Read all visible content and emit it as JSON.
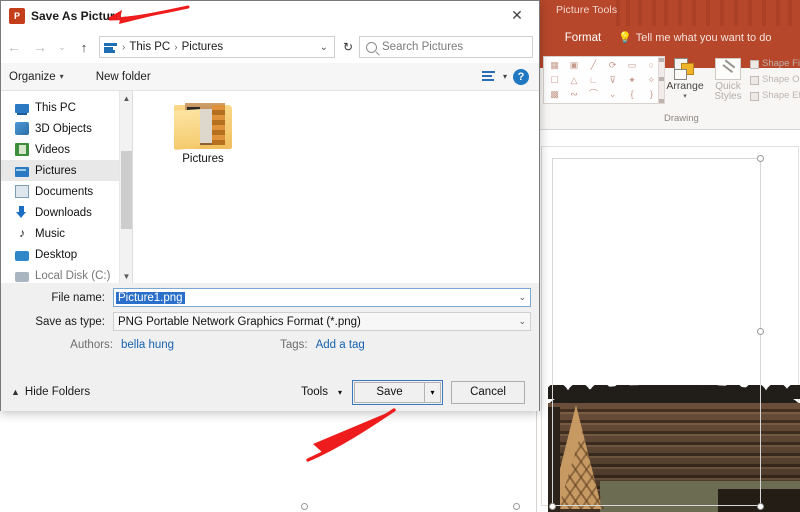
{
  "powerpoint": {
    "contextual_tab_group": "Picture Tools",
    "active_tab": "Format",
    "tell_me": "Tell me what you want to do",
    "ribbon_accent": "#b7472a",
    "drawing_group": {
      "label": "Drawing",
      "arrange_label": "Arrange",
      "quick_styles_label": "Quick Styles",
      "shape_fill_label": "Shape Fill",
      "shape_outline_label": "Shape Outline",
      "shape_effects_label": "Shape Effects"
    }
  },
  "dialog": {
    "title": "Save As Picture",
    "app_icon": "P",
    "close_icon": "close-icon",
    "nav": {
      "back_icon": "arrow-left-icon",
      "forward_icon": "arrow-right-icon",
      "recent_icon": "chevron-down-icon",
      "up_icon": "arrow-up-icon",
      "breadcrumbs": [
        "This PC",
        "Pictures"
      ],
      "separator": "›",
      "dropdown_caret": "⌄",
      "refresh_icon": "↻",
      "search_placeholder": "Search Pictures"
    },
    "toolbar": {
      "organize_label": "Organize",
      "organize_caret": "▾",
      "new_folder_label": "New folder",
      "view_icon": "view-layout-icon",
      "view_caret": "▾",
      "help_label": "?"
    },
    "nav_pane": {
      "items": [
        {
          "label": "This PC",
          "icon": "computer-icon",
          "selected": false
        },
        {
          "label": "3D Objects",
          "icon": "3d-objects-icon",
          "selected": false
        },
        {
          "label": "Videos",
          "icon": "videos-icon",
          "selected": false
        },
        {
          "label": "Pictures",
          "icon": "pictures-icon",
          "selected": true
        },
        {
          "label": "Documents",
          "icon": "documents-icon",
          "selected": false
        },
        {
          "label": "Downloads",
          "icon": "downloads-icon",
          "selected": false
        },
        {
          "label": "Music",
          "icon": "music-icon",
          "selected": false
        },
        {
          "label": "Desktop",
          "icon": "desktop-icon",
          "selected": false
        },
        {
          "label": "Local Disk (C:)",
          "icon": "disk-icon",
          "selected": false
        }
      ],
      "scroll_up_icon": "▲",
      "scroll_down_icon": "▼"
    },
    "file_list": {
      "items": [
        {
          "name": "Pictures",
          "type": "folder"
        }
      ]
    },
    "fields": {
      "file_name_label": "File name:",
      "file_name_value": "Picture1.png",
      "file_name_selected": true,
      "save_as_type_label": "Save as type:",
      "save_as_type_value": "PNG Portable Network Graphics Format (*.png)",
      "authors_label": "Authors:",
      "authors_value": "bella hung",
      "tags_label": "Tags:",
      "tags_value": "Add a tag"
    },
    "footer": {
      "hide_folders_label": "Hide Folders",
      "hide_folders_caret": "▲",
      "tools_label": "Tools",
      "tools_caret": "▾",
      "save_label": "Save",
      "save_caret": "▾",
      "cancel_label": "Cancel"
    }
  },
  "annotations": [
    {
      "name": "arrow-pointing-to-title",
      "color": "#ee1c1c",
      "direction": "left"
    },
    {
      "name": "arrow-pointing-to-save-button",
      "color": "#ee1c1c",
      "direction": "up-right"
    }
  ],
  "slide": {
    "selected_picture": "thatched-wooden-hut-photo",
    "selection_handles": 8
  }
}
